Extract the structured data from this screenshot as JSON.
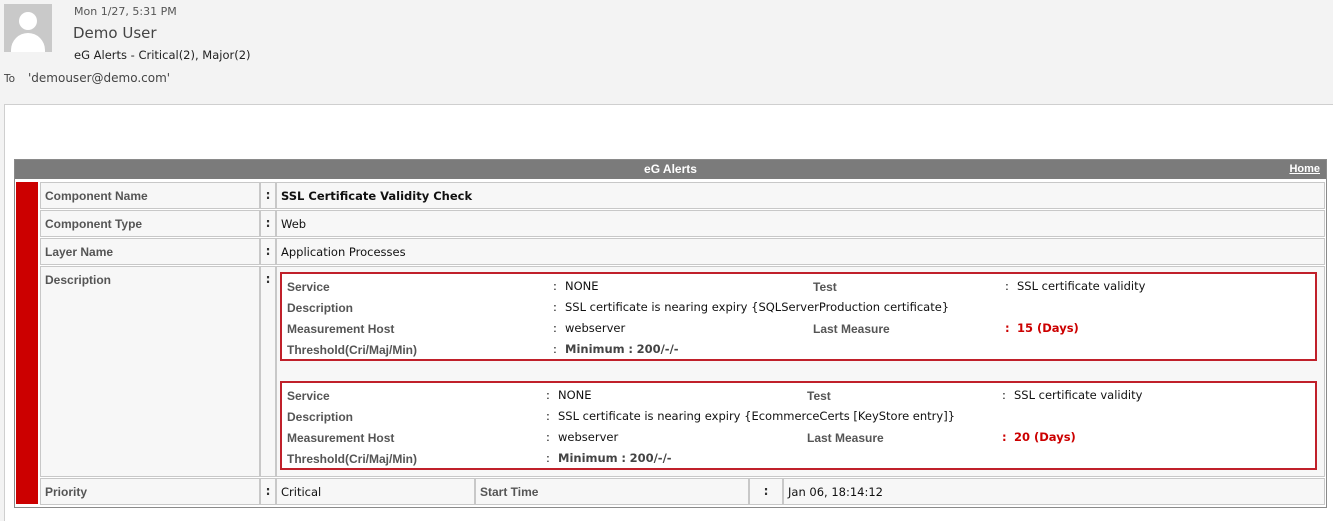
{
  "header": {
    "date": "Mon 1/27, 5:31 PM",
    "sender": "Demo User",
    "subject": "eG Alerts -  Critical(2), Major(2)",
    "to_label": "To",
    "to_value": "'demouser@demo.com'"
  },
  "alert": {
    "title": "eG Alerts",
    "home_link": "Home",
    "severity_color": "#cc0000",
    "rows": {
      "component_name": {
        "label": "Component Name",
        "value": "SSL Certificate Validity Check"
      },
      "component_type": {
        "label": "Component Type",
        "value": "Web"
      },
      "layer_name": {
        "label": "Layer Name",
        "value": "Application Processes"
      },
      "description": {
        "label": "Description"
      },
      "priority": {
        "label": "Priority",
        "value": "Critical"
      },
      "start_time": {
        "label": "Start Time",
        "value": "Jan 06, 18:14:12"
      }
    },
    "colon": ":",
    "details": [
      {
        "service_label": "Service",
        "service": "NONE",
        "test_label": "Test",
        "test": "SSL certificate validity",
        "description_label": "Description",
        "description": "SSL certificate is nearing expiry {SQLServerProduction certificate}",
        "host_label": "Measurement Host",
        "host": "webserver",
        "last_measure_label": "Last Measure",
        "last_measure": "15 (Days)",
        "threshold_label": "Threshold(Cri/Maj/Min)",
        "threshold_key": "Minimum",
        "threshold_value": "200/-/-"
      },
      {
        "service_label": "Service",
        "service": "NONE",
        "test_label": "Test",
        "test": "SSL certificate validity",
        "description_label": "Description",
        "description": "SSL certificate is nearing expiry {EcommerceCerts [KeyStore entry]}",
        "host_label": "Measurement Host",
        "host": "webserver",
        "last_measure_label": "Last Measure",
        "last_measure": "20 (Days)",
        "threshold_label": "Threshold(Cri/Maj/Min)",
        "threshold_key": "Minimum",
        "threshold_value": "200/-/-"
      }
    ]
  }
}
